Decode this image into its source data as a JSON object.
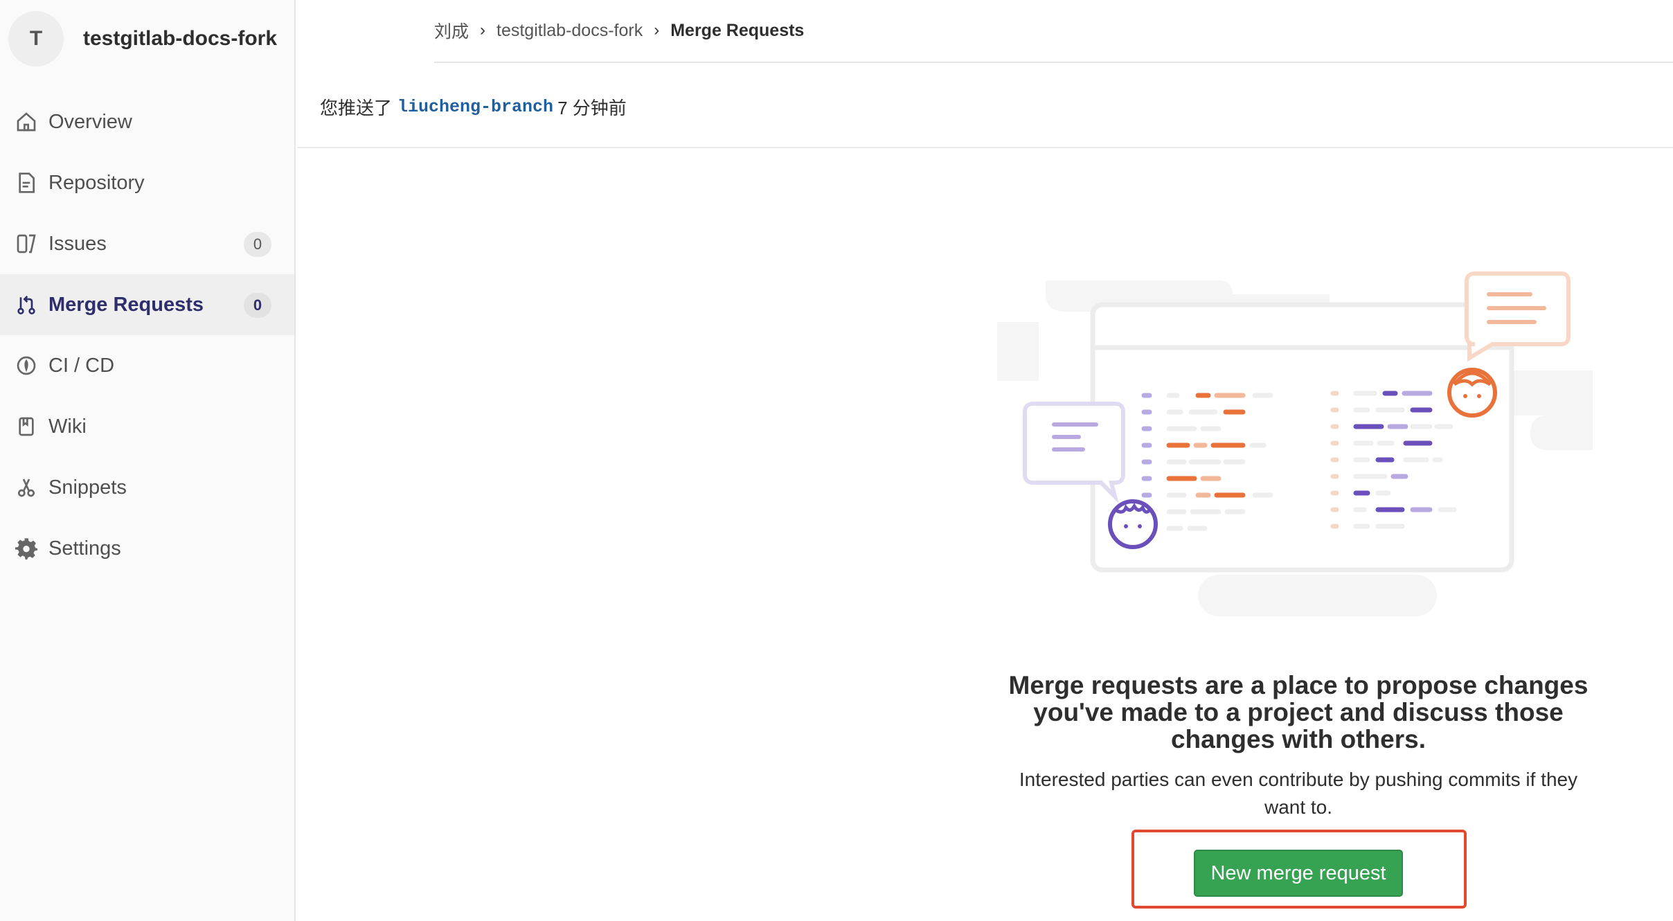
{
  "project": {
    "avatar_letter": "T",
    "name": "testgitlab-docs-fork"
  },
  "sidebar": {
    "items": [
      {
        "label": "Overview",
        "icon": "home-icon"
      },
      {
        "label": "Repository",
        "icon": "document-icon"
      },
      {
        "label": "Issues",
        "icon": "issues-icon",
        "count": "0"
      },
      {
        "label": "Merge Requests",
        "icon": "merge-request-icon",
        "count": "0",
        "active": true
      },
      {
        "label": "CI / CD",
        "icon": "rocket-icon"
      },
      {
        "label": "Wiki",
        "icon": "book-icon"
      },
      {
        "label": "Snippets",
        "icon": "scissors-icon"
      },
      {
        "label": "Settings",
        "icon": "gear-icon"
      }
    ]
  },
  "breadcrumb": {
    "user": "刘成",
    "project": "testgitlab-docs-fork",
    "current": "Merge Requests"
  },
  "push_notice": {
    "prefix": "您推送了",
    "branch": "liucheng-branch",
    "suffix": "7 分钟前"
  },
  "empty_state": {
    "title": "Merge requests are a place to propose changes you've made to a project and discuss those changes with others.",
    "text": "Interested parties can even contribute by pushing commits if they want to.",
    "button_label": "New merge request"
  },
  "colors": {
    "accent": "#36a352",
    "highlight": "#e0492f",
    "orange": "#e9713a",
    "purple": "#6b4fbb"
  }
}
